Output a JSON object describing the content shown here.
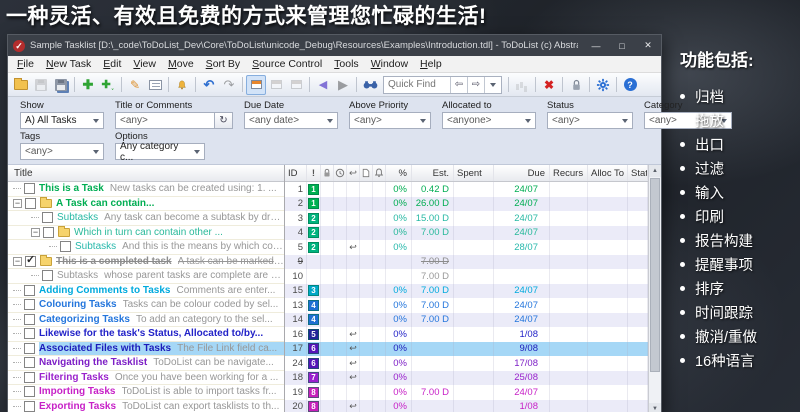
{
  "banner": {
    "text": "一种灵活、有效且免费的方式来管理您忙碌的生活!"
  },
  "sidebar": {
    "heading": "功能包括:",
    "items": [
      "归档",
      "拖放",
      "出口",
      "过滤",
      "输入",
      "印刷",
      "报告构建",
      "提醒事项",
      "排序",
      "时间跟踪",
      "撤消/重做",
      "16种语言"
    ]
  },
  "window": {
    "title": "Sample Tasklist [D:\\_code\\ToDoList_Dev\\Core\\ToDoList\\unicode_Debug\\Resources\\Examples\\Introduction.tdl] - ToDoList (c) AbstractSp...",
    "app_check": "✓",
    "controls": {
      "minimize": "—",
      "maximize": "□",
      "close": "✕"
    },
    "menus": [
      "File",
      "New Task",
      "Edit",
      "View",
      "Move",
      "Sort By",
      "Source Control",
      "Tools",
      "Window",
      "Help"
    ],
    "toolbar": {
      "quick_find": "Quick Find",
      "prev_glyph": "⇦",
      "next_glyph": "⇨"
    },
    "filters": {
      "row1": [
        {
          "label": "Show",
          "value": "A)  All Tasks"
        },
        {
          "label": "Title or Comments",
          "value": "<any>",
          "button_glyph": "↻"
        },
        {
          "label": "Due Date",
          "value": "<any date>"
        },
        {
          "label": "Above Priority",
          "value": "<any>"
        },
        {
          "label": "Allocated to",
          "value": "<anyone>"
        },
        {
          "label": "Status",
          "value": "<any>"
        },
        {
          "label": "Category",
          "value": "<any>"
        }
      ],
      "row2": [
        {
          "label": "Tags",
          "value": "<any>"
        },
        {
          "label": "Options",
          "value": "Any category c..."
        }
      ]
    },
    "grid": {
      "title_header": "Title",
      "columns": [
        {
          "label": "ID"
        },
        {
          "icon": "priority",
          "glyph": "!"
        },
        {
          "icon": "lock"
        },
        {
          "icon": "clock"
        },
        {
          "icon": "recurrence",
          "glyph": "↩"
        },
        {
          "icon": "file-link"
        },
        {
          "icon": "reminder"
        },
        {
          "label": "%"
        },
        {
          "label": "Est."
        },
        {
          "label": "Spent"
        },
        {
          "label": "Due"
        },
        {
          "label": "Recurs"
        },
        {
          "label": "Alloc To"
        },
        {
          "label": "Stat"
        }
      ],
      "recur_glyph": "↩",
      "check_glyph": "✓",
      "expand_glyph": "−",
      "rows": [
        {
          "indent": 0,
          "expand": false,
          "checked": false,
          "folder": false,
          "bold": true,
          "struck": false,
          "selected": false,
          "title": "This is a Task",
          "comment": "New tasks can be created using:  1. ...",
          "color": "#00ad52",
          "id": "1",
          "priority": "1",
          "priority_color": "#00b050",
          "pct": "0%",
          "est": "0.42 D",
          "spent": "",
          "due": "24/07",
          "recur": false
        },
        {
          "indent": 0,
          "expand": true,
          "checked": false,
          "folder": true,
          "bold": true,
          "struck": false,
          "selected": false,
          "title": "A Task can contain...",
          "comment": "",
          "color": "#00ad52",
          "id": "2",
          "priority": "1",
          "priority_color": "#00b050",
          "pct": "0%",
          "est": "26.00 D",
          "spent": "",
          "due": "24/07",
          "recur": false
        },
        {
          "indent": 1,
          "expand": false,
          "checked": false,
          "folder": false,
          "bold": false,
          "struck": false,
          "selected": false,
          "title": "Subtasks",
          "comment": "Any task can become a subtask by dra...",
          "color": "#28b9a4",
          "id": "3",
          "priority": "2",
          "priority_color": "#00b37e",
          "pct": "0%",
          "est": "15.00 D",
          "spent": "",
          "due": "24/07",
          "recur": false
        },
        {
          "indent": 1,
          "expand": true,
          "checked": false,
          "folder": true,
          "bold": false,
          "struck": false,
          "selected": false,
          "title": "Which in turn can contain other ...",
          "comment": "",
          "color": "#28b99a",
          "id": "4",
          "priority": "2",
          "priority_color": "#00b37e",
          "pct": "0%",
          "est": "7.00 D",
          "spent": "",
          "due": "24/07",
          "recur": false
        },
        {
          "indent": 2,
          "expand": false,
          "checked": false,
          "folder": false,
          "bold": false,
          "struck": false,
          "selected": false,
          "title": "Subtasks",
          "comment": "And this is the means by which com...",
          "color": "#28b9ac",
          "id": "5",
          "priority": "2",
          "priority_color": "#00b37e",
          "pct": "0%",
          "est": "",
          "spent": "",
          "due": "28/07",
          "recur": true
        },
        {
          "indent": 0,
          "expand": true,
          "checked": true,
          "folder": true,
          "bold": true,
          "struck": true,
          "selected": false,
          "title": "This is a completed task",
          "comment": "A task can be marked as...",
          "color": "#8c8c8c",
          "id": "9",
          "priority": "",
          "priority_color": "",
          "pct": "",
          "est": "7.00 D",
          "spent": "",
          "due": "",
          "recur": false
        },
        {
          "indent": 1,
          "expand": false,
          "checked": false,
          "folder": false,
          "bold": false,
          "struck": false,
          "selected": false,
          "title": "Subtasks",
          "comment": "whose parent tasks are complete are d...",
          "color": "#9a9a9a",
          "id": "10",
          "priority": "",
          "priority_color": "",
          "pct": "",
          "est": "7.00 D",
          "spent": "",
          "due": "",
          "recur": false
        },
        {
          "indent": 0,
          "expand": false,
          "checked": false,
          "folder": false,
          "bold": true,
          "struck": false,
          "selected": false,
          "title": "Adding Comments to Tasks",
          "comment": "Comments are enter...",
          "color": "#00aadd",
          "id": "15",
          "priority": "3",
          "priority_color": "#00a6c8",
          "pct": "0%",
          "est": "7.00 D",
          "spent": "",
          "due": "24/07",
          "recur": false
        },
        {
          "indent": 0,
          "expand": false,
          "checked": false,
          "folder": false,
          "bold": true,
          "struck": false,
          "selected": false,
          "title": "Colouring Tasks",
          "comment": "Tasks can be colour coded by sel...",
          "color": "#2476dc",
          "id": "13",
          "priority": "4",
          "priority_color": "#1e6fd2",
          "pct": "0%",
          "est": "7.00 D",
          "spent": "",
          "due": "24/07",
          "recur": false
        },
        {
          "indent": 0,
          "expand": false,
          "checked": false,
          "folder": false,
          "bold": true,
          "struck": false,
          "selected": false,
          "title": "Categorizing Tasks",
          "comment": "To add an category to the sel...",
          "color": "#2476dc",
          "id": "14",
          "priority": "4",
          "priority_color": "#1e6fd2",
          "pct": "0%",
          "est": "7.00 D",
          "spent": "",
          "due": "24/07",
          "recur": false
        },
        {
          "indent": 0,
          "expand": false,
          "checked": false,
          "folder": false,
          "bold": true,
          "struck": false,
          "selected": false,
          "title": "Likewise for the task's Status, Allocated to/by...",
          "comment": "",
          "color": "#2323c8",
          "id": "16",
          "priority": "5",
          "priority_color": "#232399",
          "pct": "0%",
          "est": "",
          "spent": "",
          "due": "1/08",
          "recur": true
        },
        {
          "indent": 0,
          "expand": false,
          "checked": false,
          "folder": false,
          "bold": true,
          "struck": false,
          "selected": true,
          "title": "Associated Files with Tasks",
          "comment": "The File Link field ca...",
          "color": "#1c1cba",
          "id": "17",
          "priority": "6",
          "priority_color": "#5514b8",
          "pct": "0%",
          "est": "",
          "spent": "",
          "due": "9/08",
          "recur": true
        },
        {
          "indent": 0,
          "expand": false,
          "checked": false,
          "folder": false,
          "bold": true,
          "struck": false,
          "selected": false,
          "title": "Navigating the Tasklist",
          "comment": "ToDoList can be navigate...",
          "color": "#7d1fc6",
          "id": "24",
          "priority": "6",
          "priority_color": "#5514b8",
          "pct": "0%",
          "est": "",
          "spent": "",
          "due": "17/08",
          "recur": true
        },
        {
          "indent": 0,
          "expand": false,
          "checked": false,
          "folder": false,
          "bold": true,
          "struck": false,
          "selected": false,
          "title": "Filtering Tasks",
          "comment": "Once you have been working for a ...",
          "color": "#9a22cc",
          "id": "18",
          "priority": "7",
          "priority_color": "#9a1fce",
          "pct": "0%",
          "est": "",
          "spent": "",
          "due": "25/08",
          "recur": true
        },
        {
          "indent": 0,
          "expand": false,
          "checked": false,
          "folder": false,
          "bold": true,
          "struck": false,
          "selected": false,
          "title": "Importing Tasks",
          "comment": "ToDoList is able to import tasks fr...",
          "color": "#c721c7",
          "id": "19",
          "priority": "8",
          "priority_color": "#c71fba",
          "pct": "0%",
          "est": "7.00 D",
          "spent": "",
          "due": "24/07",
          "recur": false
        },
        {
          "indent": 0,
          "expand": false,
          "checked": false,
          "folder": false,
          "bold": true,
          "struck": false,
          "selected": false,
          "title": "Exporting Tasks",
          "comment": "ToDoList can export tasklists to th...",
          "color": "#c721c7",
          "id": "20",
          "priority": "8",
          "priority_color": "#c71fba",
          "pct": "0%",
          "est": "",
          "spent": "",
          "due": "1/08",
          "recur": true
        }
      ]
    }
  }
}
